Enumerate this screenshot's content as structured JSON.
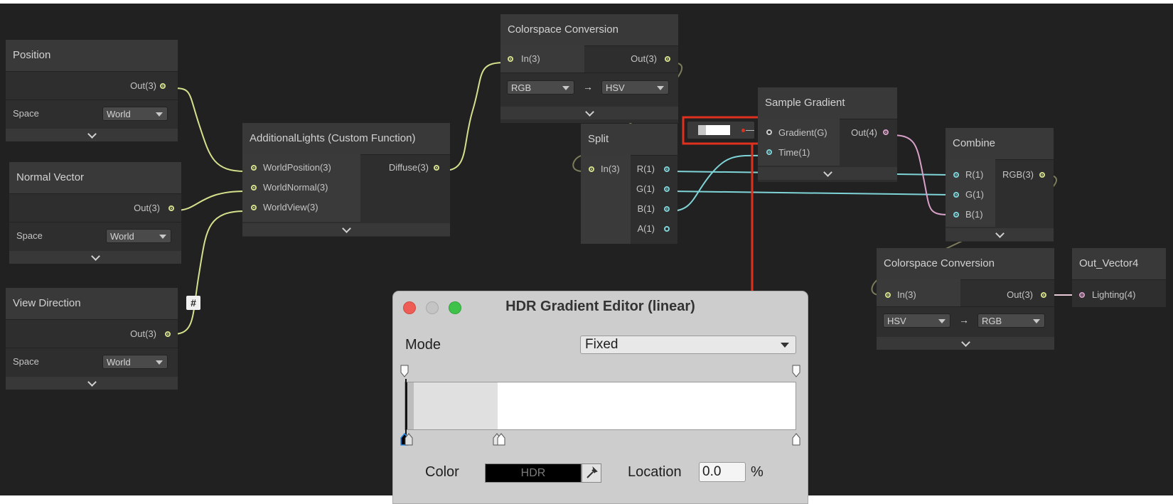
{
  "colors": {
    "canvas": "#212121",
    "vector3": "#d6e08c",
    "float": "#7fd4d8",
    "vector4": "#d8a0c8",
    "highlight": "#e0301e"
  },
  "nodes": {
    "position": {
      "title": "Position",
      "out": "Out(3)",
      "space_label": "Space",
      "space_value": "World"
    },
    "normal_vector": {
      "title": "Normal Vector",
      "out": "Out(3)",
      "space_label": "Space",
      "space_value": "World"
    },
    "view_direction": {
      "title": "View Direction",
      "out": "Out(3)",
      "space_label": "Space",
      "space_value": "World",
      "badge": "#"
    },
    "additional_lights": {
      "title": "AdditionalLights (Custom Function)",
      "in1": "WorldPosition(3)",
      "in2": "WorldNormal(3)",
      "in3": "WorldView(3)",
      "out": "Diffuse(3)"
    },
    "colorspace_top": {
      "title": "Colorspace Conversion",
      "in": "In(3)",
      "out": "Out(3)",
      "from": "RGB",
      "to": "HSV",
      "arrow": "→"
    },
    "split": {
      "title": "Split",
      "in": "In(3)",
      "out_r": "R(1)",
      "out_g": "G(1)",
      "out_b": "B(1)",
      "out_a": "A(1)"
    },
    "sample_gradient": {
      "title": "Sample Gradient",
      "in1": "Gradient(G)",
      "in2": "Time(1)",
      "out": "Out(4)"
    },
    "combine": {
      "title": "Combine",
      "in_r": "R(1)",
      "in_g": "G(1)",
      "in_b": "B(1)",
      "out": "RGB(3)"
    },
    "colorspace_bottom": {
      "title": "Colorspace Conversion",
      "in": "In(3)",
      "out": "Out(3)",
      "from": "HSV",
      "to": "RGB",
      "arrow": "→"
    },
    "out_vector4": {
      "title": "Out_Vector4",
      "in": "Lighting(4)"
    }
  },
  "dialog": {
    "title": "HDR Gradient Editor (linear)",
    "mode_label": "Mode",
    "mode_value": "Fixed",
    "color_label": "Color",
    "color_value": "HDR",
    "location_label": "Location",
    "location_value": "0.0",
    "location_unit": "%",
    "traffic_lights": [
      "#ee5c55",
      "#c4c4c4",
      "#3fc24a"
    ]
  }
}
